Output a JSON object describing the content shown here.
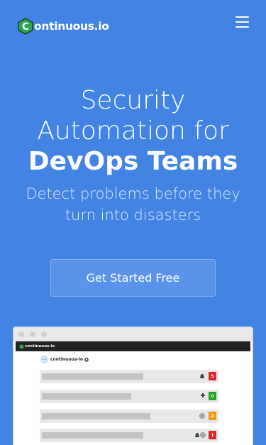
{
  "header": {
    "logo_letter": "C",
    "logo_text": "ontinuous.io",
    "menu_icon": "hamburger-icon"
  },
  "hero": {
    "line1": "Security",
    "line2": "Automation for",
    "line3": "DevOps Teams",
    "subtitle": "Detect problems before they turn into disasters",
    "cta_label": "Get Started Free"
  },
  "colors": {
    "background": "#4283e4",
    "logo_green": "#2aa552",
    "badge_red": "#e0262b",
    "badge_green": "#23a323",
    "badge_orange": "#f59a12"
  },
  "preview": {
    "app_name": "continuous.io",
    "org_name": "continuous-io",
    "repos": [
      {
        "icons": [
          "linux-icon"
        ],
        "count": "5",
        "status": "red"
      },
      {
        "icons": [
          "puzzle-icon"
        ],
        "count": "0",
        "status": "green"
      },
      {
        "icons": [
          "chrome-icon"
        ],
        "count": "2",
        "status": "orange"
      },
      {
        "icons": [
          "linux-icon",
          "chrome-icon"
        ],
        "count": "1",
        "status": "red"
      }
    ]
  }
}
